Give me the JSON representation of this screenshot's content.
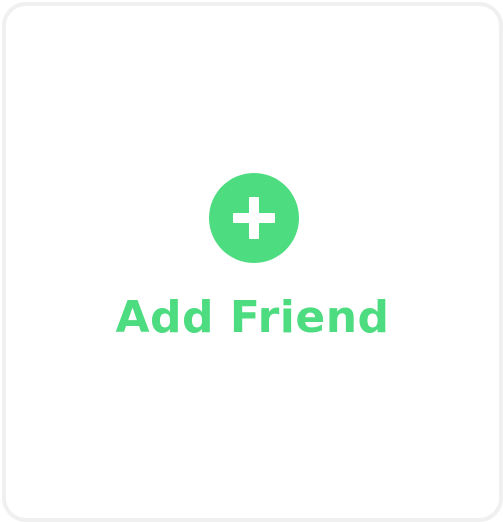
{
  "add_friend_card": {
    "label": "Add Friend",
    "accent_color": "#4ddc80",
    "icon": "plus-icon"
  }
}
